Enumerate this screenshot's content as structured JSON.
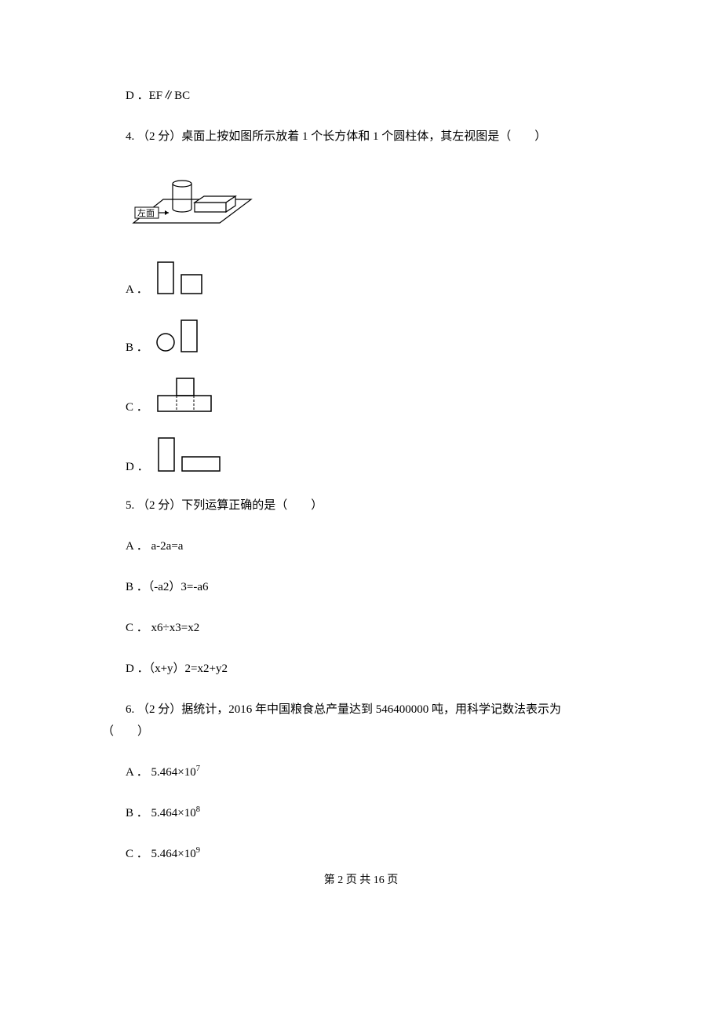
{
  "q3": {
    "optD": "D ．EF∥BC"
  },
  "q4": {
    "stem": "4. （2 分）桌面上按如图所示放着 1 个长方体和 1 个圆柱体，其左视图是（　　）",
    "optA": "A ．",
    "optB": "B ．",
    "optC": "C ．",
    "optD": "D ．"
  },
  "q5": {
    "stem": "5. （2 分）下列运算正确的是（　　）",
    "optA": "A ． a-2a=a",
    "optB": "B ．（-a2）3=-a6",
    "optC": "C ． x6÷x3=x2",
    "optD": "D ．（x+y）2=x2+y2"
  },
  "q6": {
    "stem_part1": "6. （2 分）据统计，2016 年中国粮食总产量达到 546400000 吨，用科学记数法表示为",
    "stem_part2": "（　　）",
    "optA_label": "A ．",
    "optA_base": "5.464×10",
    "optA_exp": "7",
    "optB_label": "B ．",
    "optB_base": "5.464×10",
    "optB_exp": "8",
    "optC_label": "C ．",
    "optC_base": "5.464×10",
    "optC_exp": "9"
  },
  "footer": "第 2 页 共 16 页"
}
